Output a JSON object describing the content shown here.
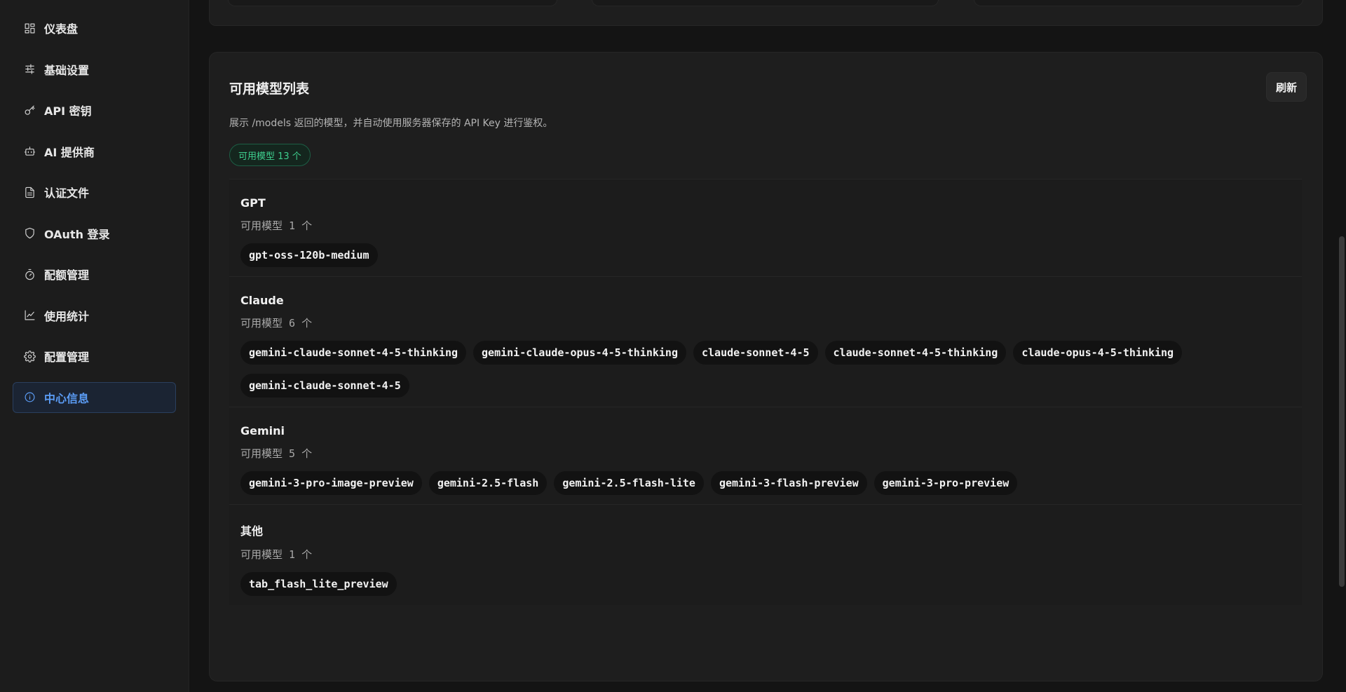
{
  "sidebar": {
    "items": [
      {
        "label": "仪表盘",
        "icon": "dashboard-grid-icon"
      },
      {
        "label": "基础设置",
        "icon": "sliders-icon"
      },
      {
        "label": "API 密钥",
        "icon": "key-icon"
      },
      {
        "label": "AI 提供商",
        "icon": "bot-icon"
      },
      {
        "label": "认证文件",
        "icon": "file-text-icon"
      },
      {
        "label": "OAuth 登录",
        "icon": "shield-icon"
      },
      {
        "label": "配额管理",
        "icon": "timer-icon"
      },
      {
        "label": "使用统计",
        "icon": "line-chart-icon"
      },
      {
        "label": "配置管理",
        "icon": "gear-icon"
      },
      {
        "label": "中心信息",
        "icon": "info-icon",
        "active": true
      }
    ],
    "accent_color": "#5b9cf5"
  },
  "models_card": {
    "title": "可用模型列表",
    "refresh_label": "刷新",
    "description": "展示 /models 返回的模型，并自动使用服务器保存的 API Key 进行鉴权。",
    "count_badge": "可用模型 13 个",
    "badge_color": "#3ecf8e",
    "groups": [
      {
        "name": "GPT",
        "count": "可用模型 1 个",
        "models": [
          "gpt-oss-120b-medium"
        ]
      },
      {
        "name": "Claude",
        "count": "可用模型 6 个",
        "models": [
          "gemini-claude-sonnet-4-5-thinking",
          "gemini-claude-opus-4-5-thinking",
          "claude-sonnet-4-5",
          "claude-sonnet-4-5-thinking",
          "claude-opus-4-5-thinking",
          "gemini-claude-sonnet-4-5"
        ]
      },
      {
        "name": "Gemini",
        "count": "可用模型 5 个",
        "models": [
          "gemini-3-pro-image-preview",
          "gemini-2.5-flash",
          "gemini-2.5-flash-lite",
          "gemini-3-flash-preview",
          "gemini-3-pro-preview"
        ]
      },
      {
        "name": "其他",
        "count": "可用模型 1 个",
        "models": [
          "tab_flash_lite_preview"
        ]
      }
    ]
  }
}
